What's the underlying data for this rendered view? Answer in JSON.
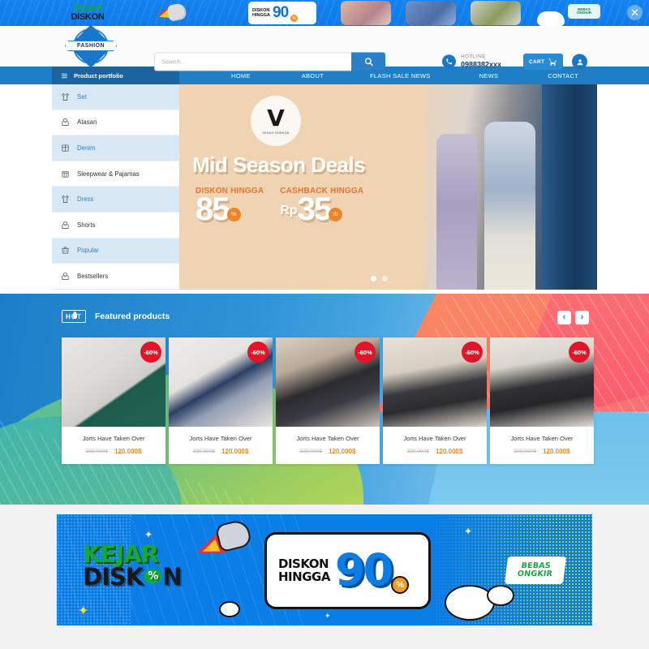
{
  "ad_strip": {
    "kejar_line1": "KEJAR",
    "kejar_line2": "DISKON",
    "promo_line1": "DISKON",
    "promo_line2": "HINGGA",
    "promo_value": "90",
    "promo_pct": "%",
    "bebas_line1": "BEBAS",
    "bebas_line2": "ONGKIR",
    "close_label": "✕"
  },
  "header": {
    "logo_text": "FASHION",
    "search": {
      "placeholder": "Search...",
      "value": "",
      "icon": "search-icon"
    },
    "hotline": {
      "label": "HOTLINE",
      "number": "0988382xxx",
      "icon": "phone-icon"
    },
    "cart": {
      "label": "CART",
      "icon": "cart-icon"
    },
    "account": {
      "icon": "user-icon"
    }
  },
  "nav": {
    "portfolio_label": "Product portfolio",
    "portfolio_icon": "hamburger-icon",
    "links": [
      "HOME",
      "ABOUT",
      "FLASH SALE NEWS",
      "NEWS",
      "CONTACT"
    ]
  },
  "sidebar": {
    "items": [
      {
        "label": "Set",
        "icon": "tshirt-icon",
        "highlighted": true
      },
      {
        "label": "Atasan",
        "icon": "hoodie-icon",
        "highlighted": false
      },
      {
        "label": "Denim",
        "icon": "denim-icon",
        "highlighted": true
      },
      {
        "label": "Sleepwear & Pajamas",
        "icon": "pajamas-icon",
        "highlighted": false
      },
      {
        "label": "Dress",
        "icon": "tshirt-icon",
        "highlighted": true
      },
      {
        "label": "Shorts",
        "icon": "hoodie-icon",
        "highlighted": false
      },
      {
        "label": "Popular",
        "icon": "basket-icon",
        "highlighted": true
      },
      {
        "label": "Bestsellers",
        "icon": "hoodie-icon",
        "highlighted": false
      }
    ]
  },
  "hero": {
    "brand_mark": "V",
    "brand_name": "VENUS FASHION",
    "title": "Mid Season Deals",
    "offers": [
      {
        "label": "DISKON HINGGA",
        "prefix": "",
        "value": "85",
        "suffix": "%"
      },
      {
        "label": "CASHBACK HINGGA",
        "prefix": "Rp",
        "value": "35",
        "suffix": "rb"
      }
    ],
    "slides": 2,
    "active_slide": 1
  },
  "featured": {
    "badge": "HOT",
    "title": "Featured products",
    "prev_icon": "chevron-left-icon",
    "next_icon": "chevron-right-icon",
    "prev_label": "‹",
    "next_label": "›",
    "products": [
      {
        "name": "Jorts Have Taken Over",
        "discount": "-60%",
        "old_price": "300.000$",
        "price": "120.000$"
      },
      {
        "name": "Jorts Have Taken Over",
        "discount": "-60%",
        "old_price": "300.000$",
        "price": "120.000$"
      },
      {
        "name": "Jorts Have Taken Over",
        "discount": "-60%",
        "old_price": "300.000$",
        "price": "120.000$"
      },
      {
        "name": "Jorts Have Taken Over",
        "discount": "-60%",
        "old_price": "300.000$",
        "price": "120.000$"
      },
      {
        "name": "Jorts Have Taken Over",
        "discount": "-60%",
        "old_price": "300.000$",
        "price": "120.000$"
      }
    ]
  },
  "bottom_banner": {
    "kejar_line1": "KEJAR",
    "kejar_line2_a": "DISK",
    "kejar_pct": "%",
    "kejar_line2_b": "N",
    "diskon_line1": "DISKON",
    "diskon_line2": "HINGGA",
    "value": "90",
    "pct": "%",
    "bebas_line1": "BEBAS",
    "bebas_line2": "ONGKIR"
  },
  "colors": {
    "brand_blue": "#1877c9",
    "nav_blue": "#1f7ec4",
    "accent_orange": "#f0892b",
    "badge_red": "#e3132a",
    "green": "#16a83d"
  }
}
